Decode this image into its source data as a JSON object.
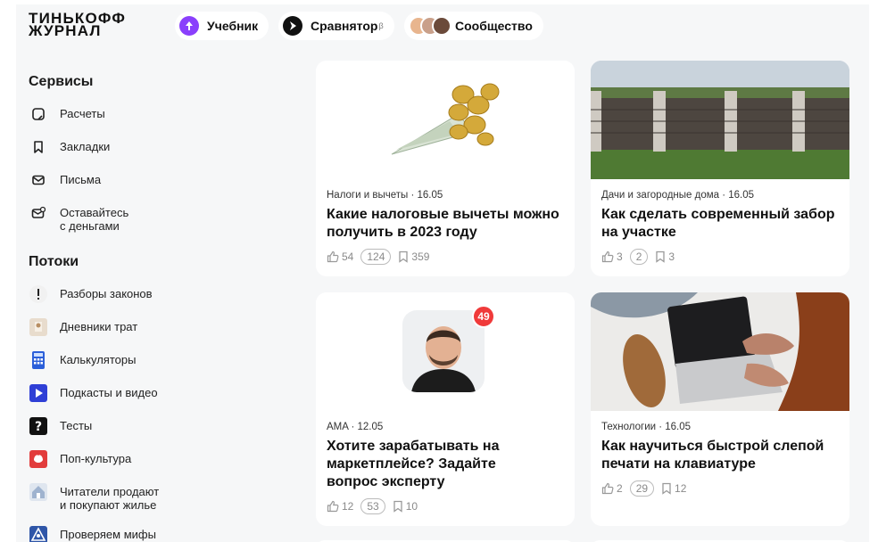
{
  "header": {
    "logo_line1": "ТИНЬКОФФ",
    "logo_line2": "ЖУРНАЛ",
    "pills": [
      {
        "label": "Учебник",
        "icon": "up-arrow-icon",
        "color": "#8a3ffc"
      },
      {
        "label": "Сравнятор",
        "sup": "β",
        "icon": "play-icon",
        "color": "#111111"
      },
      {
        "label": "Сообщество",
        "icon": "avatars-icon"
      }
    ]
  },
  "sidebar": {
    "services_title": "Сервисы",
    "services": [
      {
        "label": "Расчеты",
        "icon": "calc-icon"
      },
      {
        "label": "Закладки",
        "icon": "bookmark-icon"
      },
      {
        "label": "Письма",
        "icon": "mail-icon"
      },
      {
        "label": "Оставайтесь\nс деньгами",
        "icon": "money-mail-icon"
      }
    ],
    "streams_title": "Потоки",
    "streams": [
      {
        "label": "Разборы законов",
        "icon": "exclamation-icon"
      },
      {
        "label": "Дневники трат",
        "icon": "diary-icon"
      },
      {
        "label": "Калькуляторы",
        "icon": "calculator-icon"
      },
      {
        "label": "Подкасты и видео",
        "icon": "play-icon"
      },
      {
        "label": "Тесты",
        "icon": "question-icon"
      },
      {
        "label": "Поп-культура",
        "icon": "pop-culture-icon"
      },
      {
        "label": "Читатели продают\nи покупают жилье",
        "icon": "house-icon"
      },
      {
        "label": "Проверяем мифы",
        "icon": "pyramid-icon"
      }
    ]
  },
  "cards": [
    {
      "meta": "Налоги и вычеты · 16.05",
      "title": "Какие налоговые вычеты можно получить в 2023 году",
      "likes": "54",
      "comments": "124",
      "bookmarks": "359"
    },
    {
      "meta": "Дачи и загородные дома · 16.05",
      "title": "Как сделать современный забор на участке",
      "likes": "3",
      "comments": "2",
      "bookmarks": "3"
    },
    {
      "meta": "AMA · 12.05",
      "title": "Хотите зарабатывать на маркетплейсе? Задайте вопрос эксперту",
      "likes": "12",
      "comments": "53",
      "bookmarks": "10",
      "badge": "49"
    },
    {
      "meta": "Технологии · 16.05",
      "title": "Как научиться быстрой слепой печати на клавиатуре",
      "likes": "2",
      "comments": "29",
      "bookmarks": "12"
    }
  ],
  "colors": {
    "accent_badge": "#f03a3a",
    "background": "#f6f7f8"
  }
}
